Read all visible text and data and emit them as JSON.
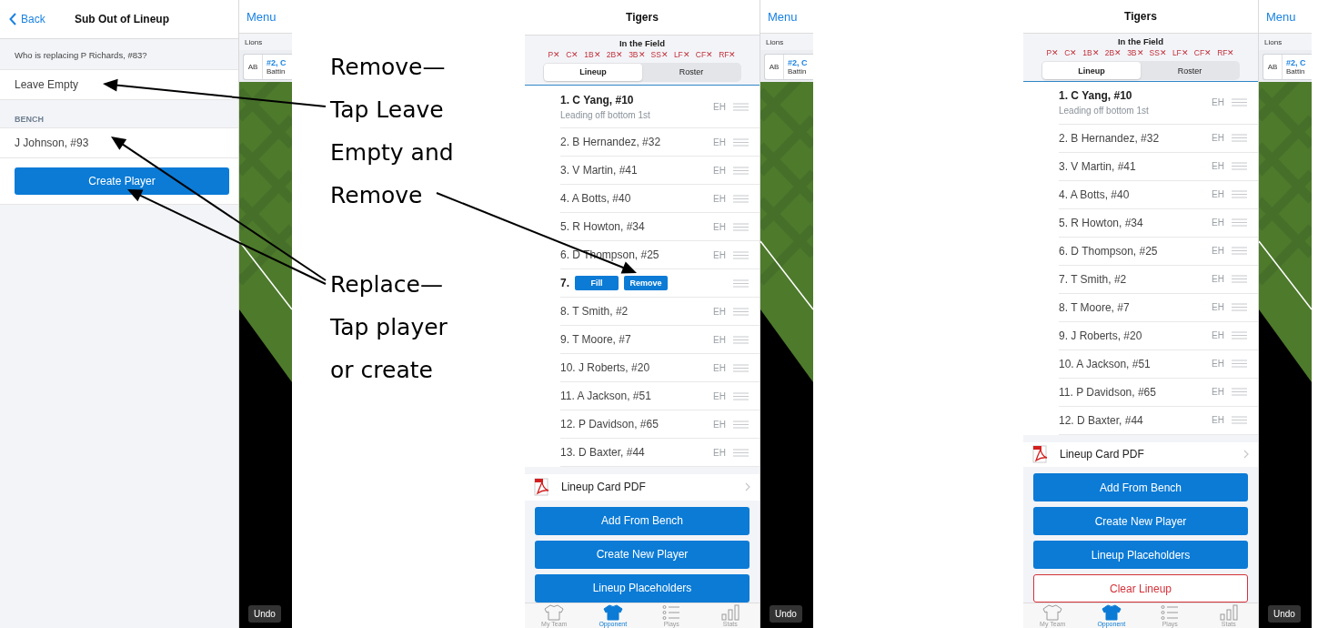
{
  "panels": [
    {
      "kind": "sub",
      "nav": {
        "back": "Back",
        "title": "Sub Out of Lineup"
      },
      "prompt": "Who is replacing P Richards, #83?",
      "options": [
        "Leave Empty"
      ],
      "section": "BENCH",
      "bench": [
        "J Johnson, #93"
      ],
      "button": "Create Player",
      "side": {
        "menu": "Menu",
        "team": "Lions",
        "card_tag": "AB",
        "card_title": "#2, C",
        "card_sub": "Battin",
        "undo": "Undo"
      }
    },
    {
      "kind": "lineup",
      "title": "Tigers",
      "field_label": "In the Field",
      "positions": [
        "P✕",
        "C✕",
        "1B✕",
        "2B✕",
        "3B✕",
        "SS✕",
        "LF✕",
        "CF✕",
        "RF✕"
      ],
      "segments": [
        {
          "label": "Lineup",
          "selected": true
        },
        {
          "label": "Roster",
          "selected": false
        }
      ],
      "rows": [
        {
          "kind": "player",
          "label": "1. C Yang, #10",
          "sub": "Leading off bottom 1st",
          "tag": "EH"
        },
        {
          "kind": "player",
          "label": "2. B Hernandez, #32",
          "tag": "EH"
        },
        {
          "kind": "player",
          "label": "3. V Martin, #41",
          "tag": "EH"
        },
        {
          "kind": "player",
          "label": "4. A Botts, #40",
          "tag": "EH"
        },
        {
          "kind": "player",
          "label": "5. R Howton, #34",
          "tag": "EH"
        },
        {
          "kind": "player",
          "label": "6. D Thompson, #25",
          "tag": "EH"
        },
        {
          "kind": "empty",
          "label": "7.",
          "actions": [
            "Fill",
            "Remove"
          ]
        },
        {
          "kind": "player",
          "label": "8. T Smith, #2",
          "tag": "EH"
        },
        {
          "kind": "player",
          "label": "9. T Moore, #7",
          "tag": "EH"
        },
        {
          "kind": "player",
          "label": "10. J Roberts, #20",
          "tag": "EH"
        },
        {
          "kind": "player",
          "label": "11. A Jackson, #51",
          "tag": "EH"
        },
        {
          "kind": "player",
          "label": "12. P Davidson, #65",
          "tag": "EH"
        },
        {
          "kind": "player",
          "label": "13. D Baxter, #44",
          "tag": "EH"
        }
      ],
      "pdf": "Lineup Card PDF",
      "buttons": [
        {
          "label": "Add From Bench",
          "kind": "primary"
        },
        {
          "label": "Create New Player",
          "kind": "primary"
        },
        {
          "label": "Lineup Placeholders",
          "kind": "primary"
        }
      ],
      "tabs": [
        {
          "label": "My Team",
          "selected": false
        },
        {
          "label": "Opponent",
          "selected": true
        },
        {
          "label": "Plays",
          "selected": false
        },
        {
          "label": "Stats",
          "selected": false
        }
      ],
      "side": {
        "menu": "Menu",
        "team": "Lions",
        "card_tag": "AB",
        "card_title": "#2, C",
        "card_sub": "Battin",
        "undo": "Undo"
      }
    },
    {
      "kind": "lineup",
      "title": "Tigers",
      "field_label": "In the Field",
      "positions": [
        "P✕",
        "C✕",
        "1B✕",
        "2B✕",
        "3B✕",
        "SS✕",
        "LF✕",
        "CF✕",
        "RF✕"
      ],
      "segments": [
        {
          "label": "Lineup",
          "selected": true
        },
        {
          "label": "Roster",
          "selected": false
        }
      ],
      "rows": [
        {
          "kind": "player",
          "label": "1. C Yang, #10",
          "sub": "Leading off bottom 1st",
          "tag": "EH"
        },
        {
          "kind": "player",
          "label": "2. B Hernandez, #32",
          "tag": "EH"
        },
        {
          "kind": "player",
          "label": "3. V Martin, #41",
          "tag": "EH"
        },
        {
          "kind": "player",
          "label": "4. A Botts, #40",
          "tag": "EH"
        },
        {
          "kind": "player",
          "label": "5. R Howton, #34",
          "tag": "EH"
        },
        {
          "kind": "player",
          "label": "6. D Thompson, #25",
          "tag": "EH"
        },
        {
          "kind": "player",
          "label": "7. T Smith, #2",
          "tag": "EH"
        },
        {
          "kind": "player",
          "label": "8. T Moore, #7",
          "tag": "EH"
        },
        {
          "kind": "player",
          "label": "9. J Roberts, #20",
          "tag": "EH"
        },
        {
          "kind": "player",
          "label": "10. A Jackson, #51",
          "tag": "EH"
        },
        {
          "kind": "player",
          "label": "11. P Davidson, #65",
          "tag": "EH"
        },
        {
          "kind": "player",
          "label": "12. D Baxter, #44",
          "tag": "EH"
        }
      ],
      "pdf": "Lineup Card PDF",
      "buttons": [
        {
          "label": "Add From Bench",
          "kind": "primary"
        },
        {
          "label": "Create New Player",
          "kind": "primary"
        },
        {
          "label": "Lineup Placeholders",
          "kind": "primary"
        },
        {
          "label": "Clear Lineup",
          "kind": "danger"
        }
      ],
      "tabs": [
        {
          "label": "My Team",
          "selected": false
        },
        {
          "label": "Opponent",
          "selected": true
        },
        {
          "label": "Plays",
          "selected": false
        },
        {
          "label": "Stats",
          "selected": false
        }
      ],
      "side": {
        "menu": "Menu",
        "team": "Lions",
        "card_tag": "AB",
        "card_title": "#2, C",
        "card_sub": "Battin",
        "undo": "Undo"
      }
    }
  ],
  "annotations": [
    {
      "lines": [
        "Remove—",
        "Tap Leave",
        "Empty and",
        "Remove"
      ]
    },
    {
      "lines": [
        "Replace—",
        "Tap player",
        "or create"
      ]
    }
  ]
}
